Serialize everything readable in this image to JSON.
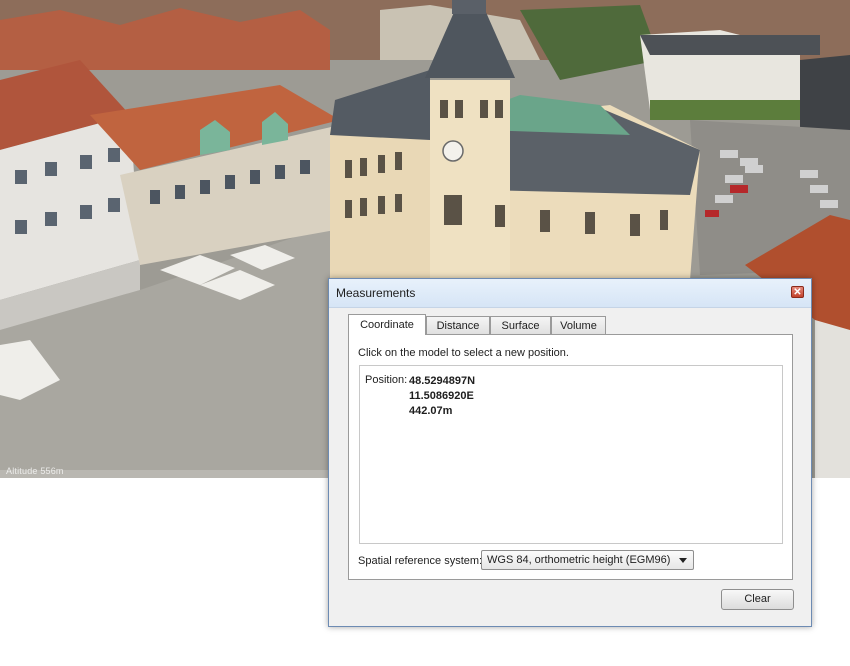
{
  "scene": {
    "status_text": "Altitude 556m"
  },
  "dialog": {
    "title": "Measurements",
    "close_glyph": "✕",
    "tabs": [
      {
        "label": "Coordinate",
        "active": true
      },
      {
        "label": "Distance",
        "active": false
      },
      {
        "label": "Surface",
        "active": false
      },
      {
        "label": "Volume",
        "active": false
      }
    ],
    "instruction": "Click on the model to select a new position.",
    "position": {
      "label": "Position:",
      "latitude": "48.5294897N",
      "longitude": "11.5086920E",
      "height": "442.07m"
    },
    "srs": {
      "label": "Spatial reference system:",
      "selected": "WGS 84, orthometric height (EGM96)"
    },
    "clear_label": "Clear"
  },
  "colors": {
    "title_bar": "#d6e5f6",
    "close_button": "#c2412b",
    "dialog_bg": "#f0f0f0",
    "panel_bg": "#ffffff"
  }
}
